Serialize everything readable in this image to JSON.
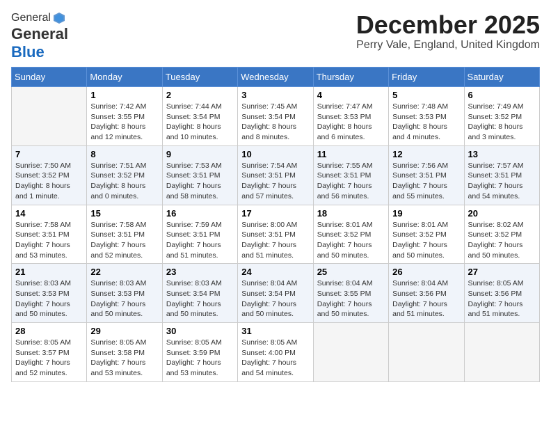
{
  "logo": {
    "general": "General",
    "blue": "Blue"
  },
  "title": "December 2025",
  "location": "Perry Vale, England, United Kingdom",
  "days_of_week": [
    "Sunday",
    "Monday",
    "Tuesday",
    "Wednesday",
    "Thursday",
    "Friday",
    "Saturday"
  ],
  "weeks": [
    [
      {
        "day": "",
        "info": ""
      },
      {
        "day": "1",
        "info": "Sunrise: 7:42 AM\nSunset: 3:55 PM\nDaylight: 8 hours\nand 12 minutes."
      },
      {
        "day": "2",
        "info": "Sunrise: 7:44 AM\nSunset: 3:54 PM\nDaylight: 8 hours\nand 10 minutes."
      },
      {
        "day": "3",
        "info": "Sunrise: 7:45 AM\nSunset: 3:54 PM\nDaylight: 8 hours\nand 8 minutes."
      },
      {
        "day": "4",
        "info": "Sunrise: 7:47 AM\nSunset: 3:53 PM\nDaylight: 8 hours\nand 6 minutes."
      },
      {
        "day": "5",
        "info": "Sunrise: 7:48 AM\nSunset: 3:53 PM\nDaylight: 8 hours\nand 4 minutes."
      },
      {
        "day": "6",
        "info": "Sunrise: 7:49 AM\nSunset: 3:52 PM\nDaylight: 8 hours\nand 3 minutes."
      }
    ],
    [
      {
        "day": "7",
        "info": "Sunrise: 7:50 AM\nSunset: 3:52 PM\nDaylight: 8 hours\nand 1 minute."
      },
      {
        "day": "8",
        "info": "Sunrise: 7:51 AM\nSunset: 3:52 PM\nDaylight: 8 hours\nand 0 minutes."
      },
      {
        "day": "9",
        "info": "Sunrise: 7:53 AM\nSunset: 3:51 PM\nDaylight: 7 hours\nand 58 minutes."
      },
      {
        "day": "10",
        "info": "Sunrise: 7:54 AM\nSunset: 3:51 PM\nDaylight: 7 hours\nand 57 minutes."
      },
      {
        "day": "11",
        "info": "Sunrise: 7:55 AM\nSunset: 3:51 PM\nDaylight: 7 hours\nand 56 minutes."
      },
      {
        "day": "12",
        "info": "Sunrise: 7:56 AM\nSunset: 3:51 PM\nDaylight: 7 hours\nand 55 minutes."
      },
      {
        "day": "13",
        "info": "Sunrise: 7:57 AM\nSunset: 3:51 PM\nDaylight: 7 hours\nand 54 minutes."
      }
    ],
    [
      {
        "day": "14",
        "info": "Sunrise: 7:58 AM\nSunset: 3:51 PM\nDaylight: 7 hours\nand 53 minutes."
      },
      {
        "day": "15",
        "info": "Sunrise: 7:58 AM\nSunset: 3:51 PM\nDaylight: 7 hours\nand 52 minutes."
      },
      {
        "day": "16",
        "info": "Sunrise: 7:59 AM\nSunset: 3:51 PM\nDaylight: 7 hours\nand 51 minutes."
      },
      {
        "day": "17",
        "info": "Sunrise: 8:00 AM\nSunset: 3:51 PM\nDaylight: 7 hours\nand 51 minutes."
      },
      {
        "day": "18",
        "info": "Sunrise: 8:01 AM\nSunset: 3:52 PM\nDaylight: 7 hours\nand 50 minutes."
      },
      {
        "day": "19",
        "info": "Sunrise: 8:01 AM\nSunset: 3:52 PM\nDaylight: 7 hours\nand 50 minutes."
      },
      {
        "day": "20",
        "info": "Sunrise: 8:02 AM\nSunset: 3:52 PM\nDaylight: 7 hours\nand 50 minutes."
      }
    ],
    [
      {
        "day": "21",
        "info": "Sunrise: 8:03 AM\nSunset: 3:53 PM\nDaylight: 7 hours\nand 50 minutes."
      },
      {
        "day": "22",
        "info": "Sunrise: 8:03 AM\nSunset: 3:53 PM\nDaylight: 7 hours\nand 50 minutes."
      },
      {
        "day": "23",
        "info": "Sunrise: 8:03 AM\nSunset: 3:54 PM\nDaylight: 7 hours\nand 50 minutes."
      },
      {
        "day": "24",
        "info": "Sunrise: 8:04 AM\nSunset: 3:54 PM\nDaylight: 7 hours\nand 50 minutes."
      },
      {
        "day": "25",
        "info": "Sunrise: 8:04 AM\nSunset: 3:55 PM\nDaylight: 7 hours\nand 50 minutes."
      },
      {
        "day": "26",
        "info": "Sunrise: 8:04 AM\nSunset: 3:56 PM\nDaylight: 7 hours\nand 51 minutes."
      },
      {
        "day": "27",
        "info": "Sunrise: 8:05 AM\nSunset: 3:56 PM\nDaylight: 7 hours\nand 51 minutes."
      }
    ],
    [
      {
        "day": "28",
        "info": "Sunrise: 8:05 AM\nSunset: 3:57 PM\nDaylight: 7 hours\nand 52 minutes."
      },
      {
        "day": "29",
        "info": "Sunrise: 8:05 AM\nSunset: 3:58 PM\nDaylight: 7 hours\nand 53 minutes."
      },
      {
        "day": "30",
        "info": "Sunrise: 8:05 AM\nSunset: 3:59 PM\nDaylight: 7 hours\nand 53 minutes."
      },
      {
        "day": "31",
        "info": "Sunrise: 8:05 AM\nSunset: 4:00 PM\nDaylight: 7 hours\nand 54 minutes."
      },
      {
        "day": "",
        "info": ""
      },
      {
        "day": "",
        "info": ""
      },
      {
        "day": "",
        "info": ""
      }
    ]
  ]
}
